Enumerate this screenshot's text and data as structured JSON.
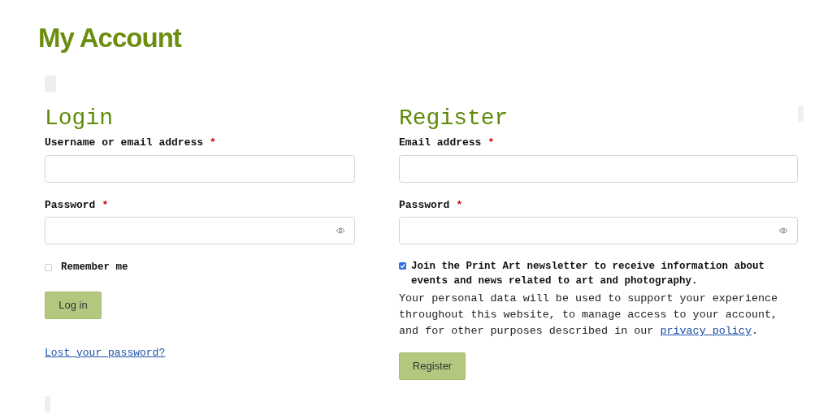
{
  "title": "My Account",
  "login": {
    "heading": "Login",
    "fields": [
      {
        "kind": "text",
        "label": "Username or email address",
        "required_mark": "*"
      },
      {
        "kind": "password",
        "label": "Password",
        "required_mark": "*"
      }
    ],
    "remember": {
      "label": "Remember me",
      "checked": false
    },
    "button": "Log in",
    "link": "Lost your password?"
  },
  "register": {
    "heading": "Register",
    "fields": [
      {
        "kind": "text",
        "label": "Email address",
        "required_mark": "*"
      },
      {
        "kind": "password",
        "label": "Password",
        "required_mark": "*"
      }
    ],
    "newsletter": {
      "label": "Join the Print Art newsletter to receive information about events and news related to art and photography.",
      "checked": true
    },
    "privacy": {
      "text": "Your personal data will be used to support your experience throughout this website, to manage access to your account, and for other purposes described in our",
      "link": "privacy policy",
      "end": "."
    },
    "button": "Register"
  }
}
